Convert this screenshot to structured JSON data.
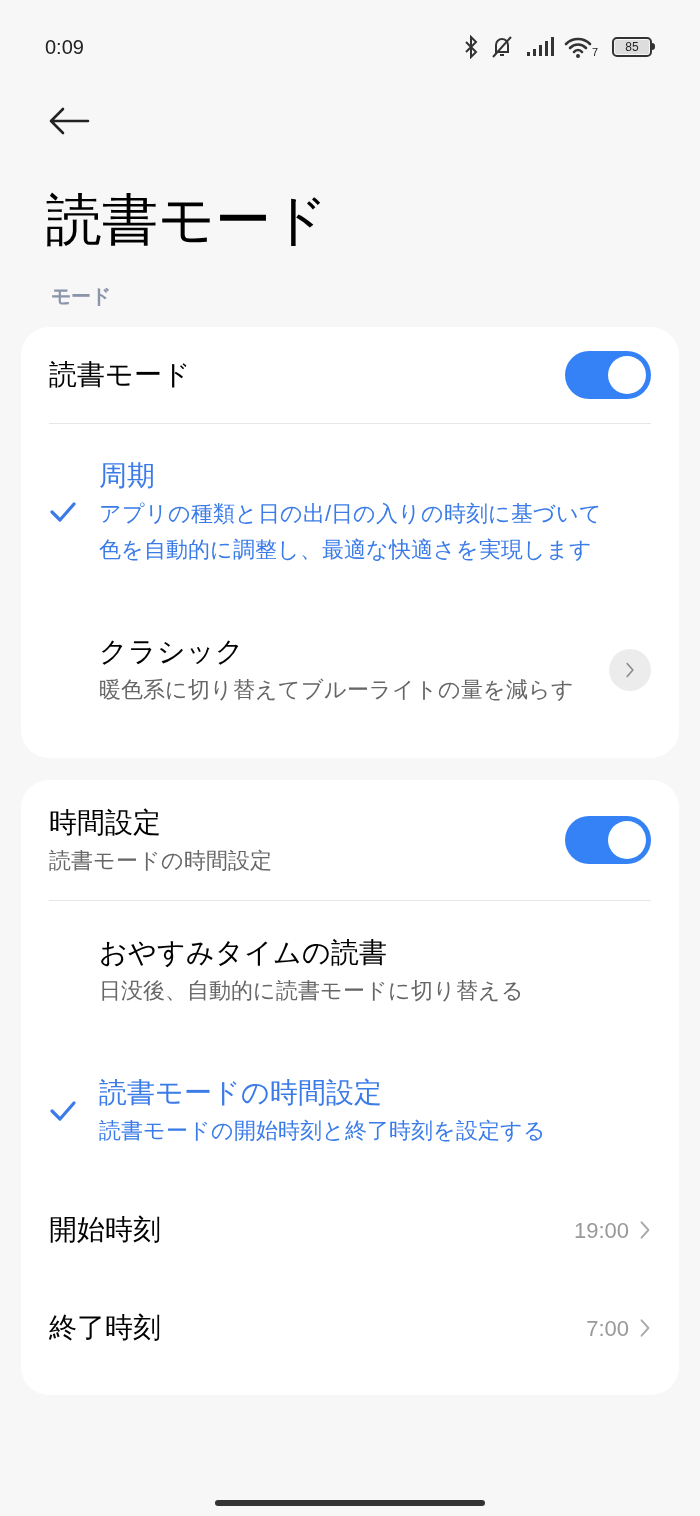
{
  "status_bar": {
    "time": "0:09",
    "wifi_badge": "7",
    "battery": "85"
  },
  "title": "読書モード",
  "section_label": "モード",
  "cards": [
    {
      "toggle": {
        "label": "読書モード",
        "on": true
      },
      "options": [
        {
          "title": "周期",
          "description": "アプリの種類と日の出/日の入りの時刻に基づいて色を自動的に調整し、最適な快適さを実現します",
          "selected": true,
          "has_detail": false
        },
        {
          "title": "クラシック",
          "description": "暖色系に切り替えてブルーライトの量を減らす",
          "selected": false,
          "has_detail": true
        }
      ]
    },
    {
      "toggle": {
        "label": "時間設定",
        "subtitle": "読書モードの時間設定",
        "on": true
      },
      "options": [
        {
          "title": "おやすみタイムの読書",
          "description": "日没後、自動的に読書モードに切り替える",
          "selected": false,
          "has_detail": false
        },
        {
          "title": "読書モードの時間設定",
          "description": "読書モードの開始時刻と終了時刻を設定する",
          "selected": true,
          "has_detail": false
        }
      ],
      "rows": [
        {
          "label": "開始時刻",
          "value": "19:00"
        },
        {
          "label": "終了時刻",
          "value": "7:00"
        }
      ]
    }
  ]
}
